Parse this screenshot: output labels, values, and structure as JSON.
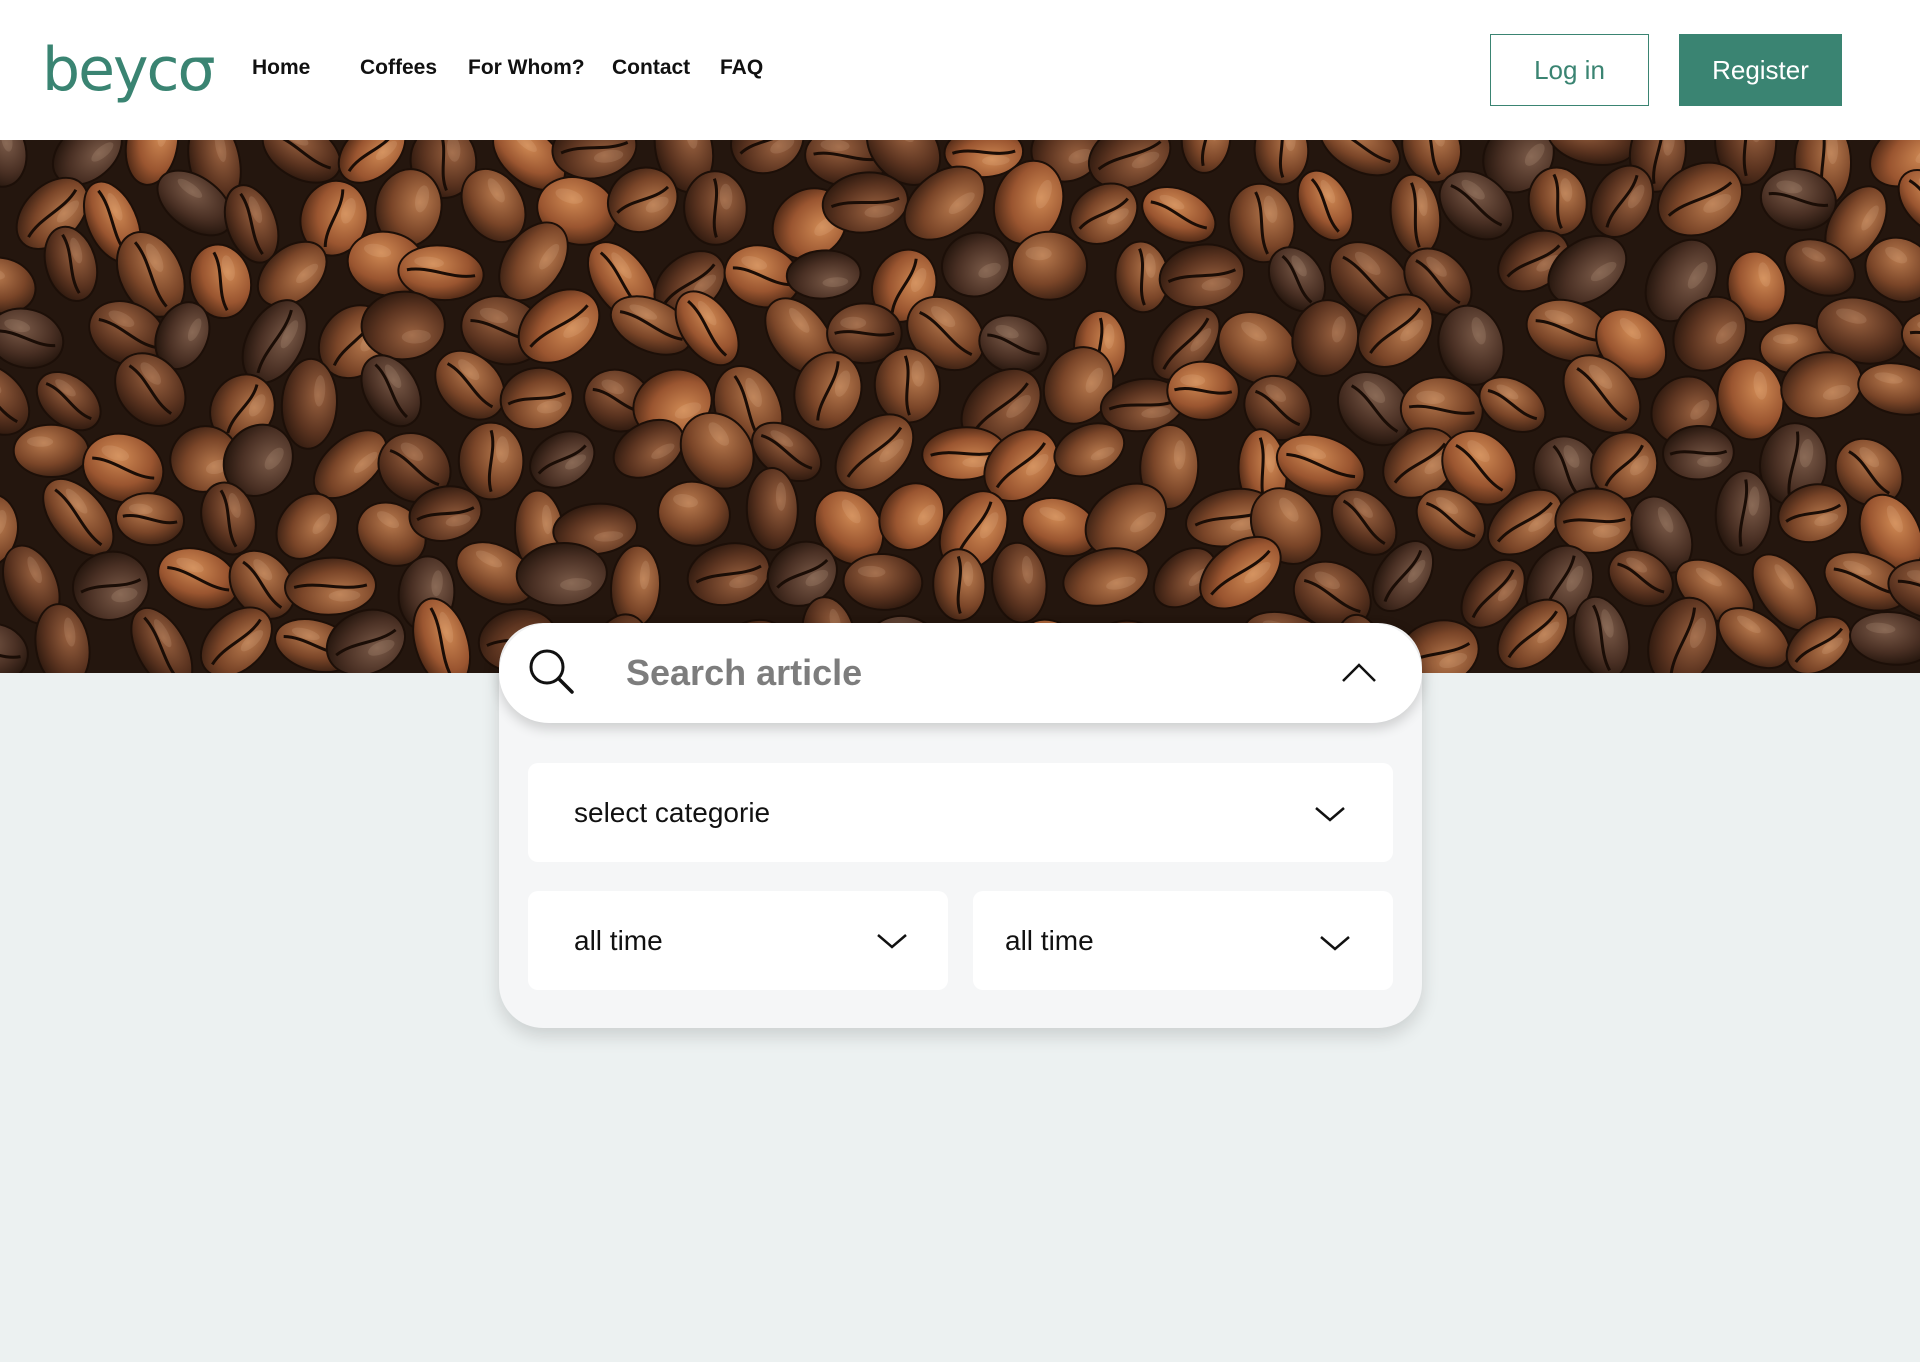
{
  "brand": {
    "logo_text": "beycσ",
    "color": "#3a8472"
  },
  "nav": {
    "items": [
      {
        "label": "Home"
      },
      {
        "label": "Coffees"
      },
      {
        "label": "For Whom?"
      },
      {
        "label": "Contact"
      },
      {
        "label": "FAQ"
      }
    ]
  },
  "auth": {
    "login_label": "Log in",
    "register_label": "Register"
  },
  "search": {
    "placeholder": "Search article",
    "search_icon": "search-icon",
    "toggle_icon": "chevron-up-icon"
  },
  "filters": {
    "category": {
      "selected": "select categorie",
      "icon": "chevron-down-icon"
    },
    "time_from": {
      "selected": "all time",
      "icon": "chevron-down-icon"
    },
    "time_to": {
      "selected": "all time",
      "icon": "chevron-down-icon"
    }
  },
  "colors": {
    "accent": "#3a8472",
    "page_background": "#ecf1f1",
    "panel_background": "#f5f6f7"
  }
}
